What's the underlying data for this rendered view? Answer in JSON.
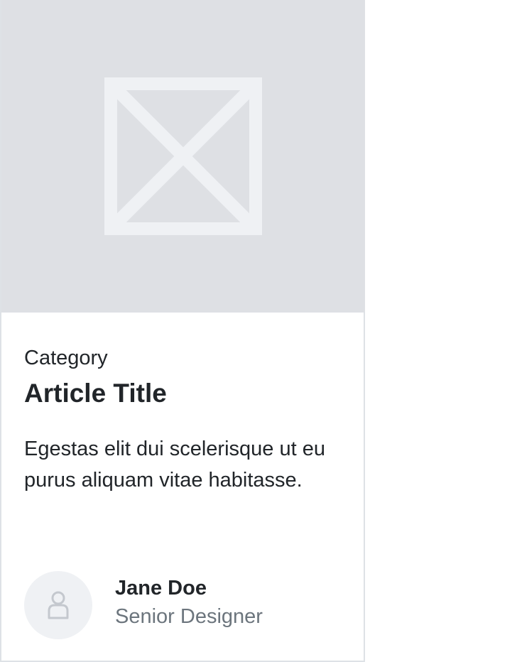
{
  "card": {
    "image": {
      "icon": "image-placeholder-icon",
      "background_color": "#dee0e4",
      "icon_color": "#eff1f4"
    },
    "category": "Category",
    "title": "Article Title",
    "description": "Egestas elit dui scelerisque ut eu purus aliquam vitae habitasse.",
    "author": {
      "avatar_icon": "user-icon",
      "name": "Jane Doe",
      "role": "Senior Designer"
    }
  },
  "colors": {
    "text_primary": "#212529",
    "text_secondary": "#6c757d",
    "border": "#dee2e6"
  }
}
